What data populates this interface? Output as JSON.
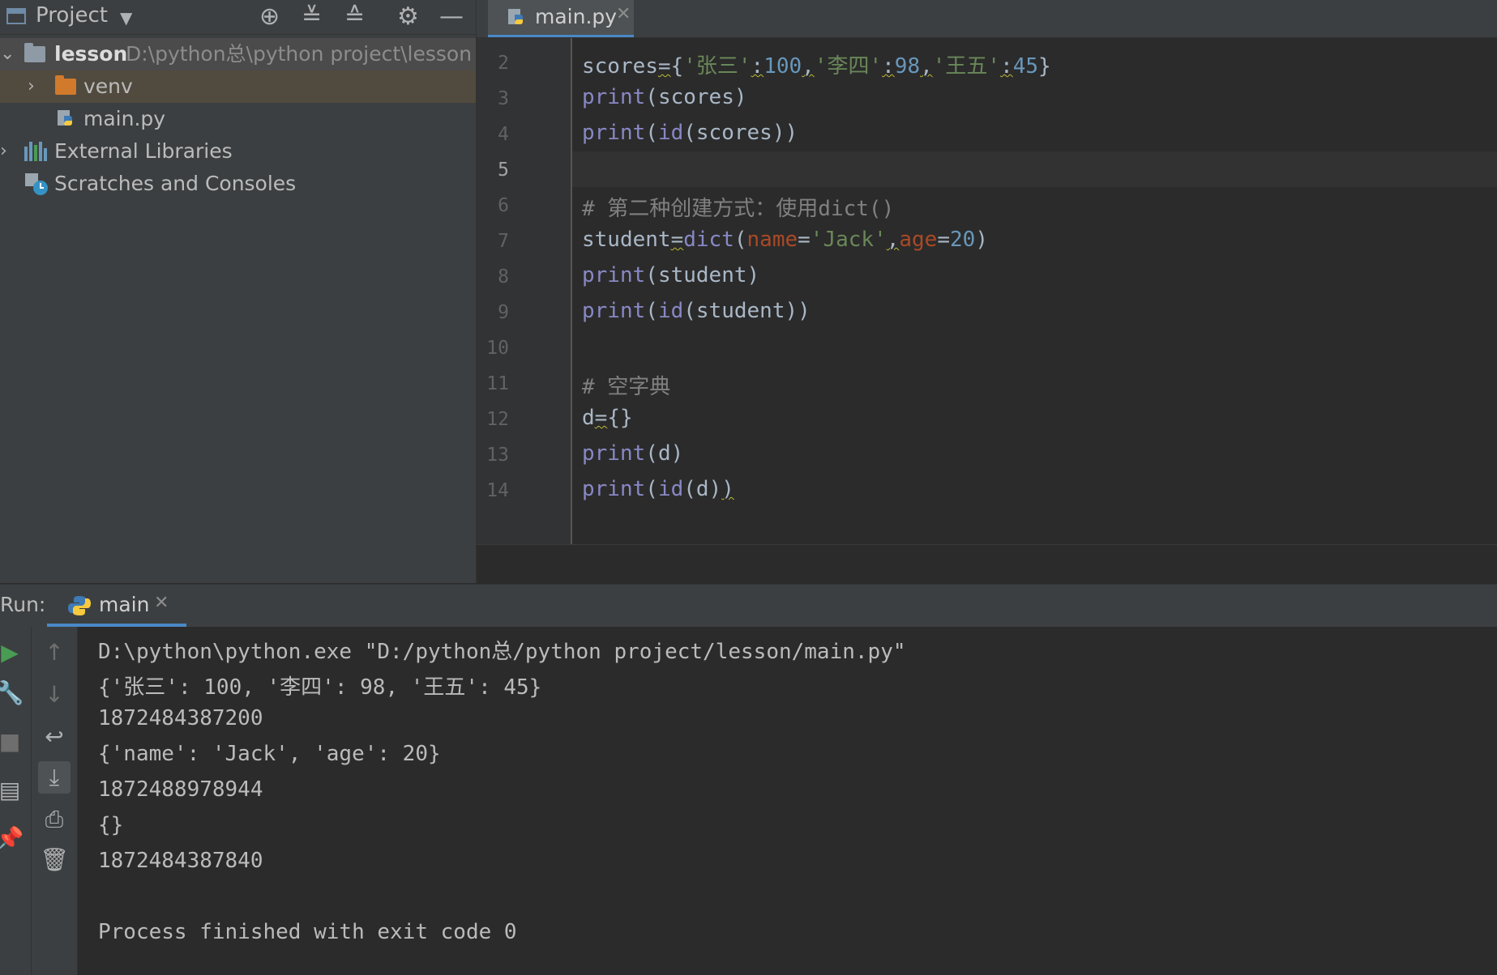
{
  "project_panel": {
    "title": "Project",
    "tree": [
      {
        "label": "lesson",
        "path": "D:\\python总\\python project\\lesson"
      },
      {
        "label": "venv"
      },
      {
        "label": "main.py"
      },
      {
        "label": "External Libraries"
      },
      {
        "label": "Scratches and Consoles"
      }
    ]
  },
  "editor": {
    "tab_label": "main.py",
    "line_numbers": [
      "2",
      "3",
      "4",
      "5",
      "6",
      "7",
      "8",
      "9",
      "10",
      "11",
      "12",
      "13",
      "14"
    ],
    "current_line": "5",
    "tokens": {
      "l2": [
        "scores",
        "=",
        "{",
        "'张三'",
        ":",
        "100",
        ",",
        "'李四'",
        ":",
        "98",
        ",",
        "'王五'",
        ":",
        "45",
        "}"
      ],
      "l3": [
        "print",
        "(",
        "scores",
        ")"
      ],
      "l4": [
        "print",
        "(",
        "id",
        "(",
        "scores",
        "))"
      ],
      "l6": "# 第二种创建方式：使用dict()",
      "l7": [
        "student",
        "=",
        "dict",
        "(",
        "name",
        "=",
        "'Jack'",
        ",",
        "age",
        "=",
        "20",
        ")"
      ],
      "l8": [
        "print",
        "(",
        "student",
        ")"
      ],
      "l9": [
        "print",
        "(",
        "id",
        "(",
        "student",
        "))"
      ],
      "l11": "# 空字典",
      "l12": [
        "d",
        "=",
        "{}"
      ],
      "l13": [
        "print",
        "(",
        "d",
        ")"
      ],
      "l14": [
        "print",
        "(",
        "id",
        "(",
        "d",
        ")",
        ")"
      ]
    }
  },
  "run_panel": {
    "label": "Run:",
    "tab_label": "main",
    "output": [
      "D:\\python\\python.exe \"D:/python总/python project/lesson/main.py\"",
      "{'张三': 100, '李四': 98, '王五': 45}",
      "1872484387200",
      "{'name': 'Jack', 'age': 20}",
      "1872488978944",
      "{}",
      "1872484387840",
      "",
      "Process finished with exit code 0"
    ]
  },
  "icons": {
    "locate": "crosshair-icon",
    "expand": "expand-all-icon",
    "collapse": "collapse-all-icon",
    "settings": "gear-icon",
    "hide": "minimize-icon",
    "rerun": "play-icon",
    "edit": "wrench-icon",
    "stop": "stop-icon",
    "layout": "layout-icon",
    "pin": "pin-icon",
    "up": "arrow-up-icon",
    "down": "arrow-down-icon",
    "wrap": "soft-wrap-icon",
    "scroll": "scroll-to-end-icon",
    "print": "printer-icon",
    "clear": "trash-icon"
  },
  "colors": {
    "accent": "#4a88c7",
    "keyword": "#8888c6",
    "string": "#6a8759",
    "number": "#6897bb",
    "param": "#aa4926",
    "comment": "#808080",
    "run_green": "#499c54",
    "folder_orange": "#d17a2b"
  }
}
